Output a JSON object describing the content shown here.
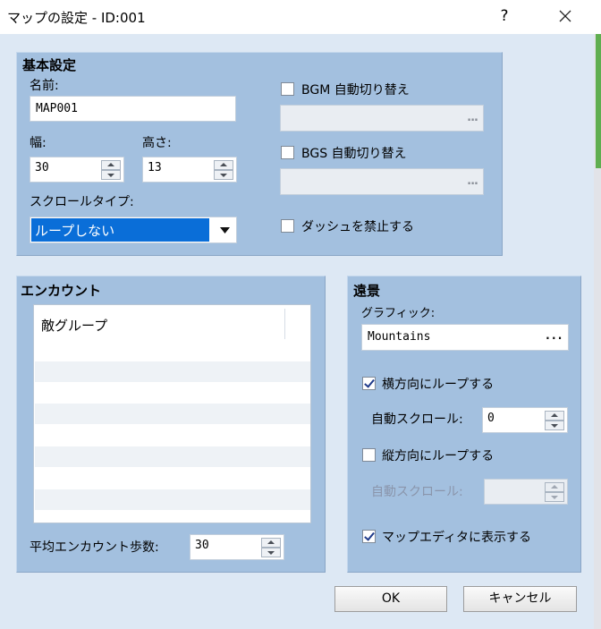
{
  "window": {
    "title": "マップの設定 - ID:001",
    "help": "?"
  },
  "basic": {
    "title": "基本設定",
    "name_label": "名前:",
    "name_value": "MAP001",
    "width_label": "幅:",
    "width_value": "30",
    "height_label": "高さ:",
    "height_value": "13",
    "scroll_label": "スクロールタイプ:",
    "scroll_value": "ループしない",
    "bgm_label": "BGM 自動切り替え",
    "bgm_checked": false,
    "bgs_label": "BGS 自動切り替え",
    "bgs_checked": false,
    "dash_label": "ダッシュを禁止する",
    "dash_checked": false,
    "ellipsis": "..."
  },
  "encounter": {
    "title": "エンカウント",
    "column_header": "敵グループ",
    "rows": [],
    "steps_label": "平均エンカウント歩数:",
    "steps_value": "30"
  },
  "parallax": {
    "title": "遠景",
    "graphic_label": "グラフィック:",
    "graphic_value": "Mountains",
    "loop_h_label": "横方向にループする",
    "loop_h_checked": true,
    "auto_scroll_label": "自動スクロール:",
    "auto_scroll_h_value": "0",
    "loop_v_label": "縦方向にループする",
    "loop_v_checked": false,
    "auto_scroll_v_label": "自動スクロール:",
    "auto_scroll_v_value": "",
    "show_in_editor_label": "マップエディタに表示する",
    "show_in_editor_checked": true,
    "ellipsis": "..."
  },
  "buttons": {
    "ok": "OK",
    "cancel": "キャンセル"
  },
  "colors": {
    "group_bg": "#a3c0df",
    "client_bg": "#dde8f4",
    "selection": "#0a6ed8"
  },
  "icons": [
    "close-icon",
    "help-icon",
    "dropdown-arrow-icon",
    "spin-up-icon",
    "spin-down-icon",
    "checkbox-icon"
  ]
}
